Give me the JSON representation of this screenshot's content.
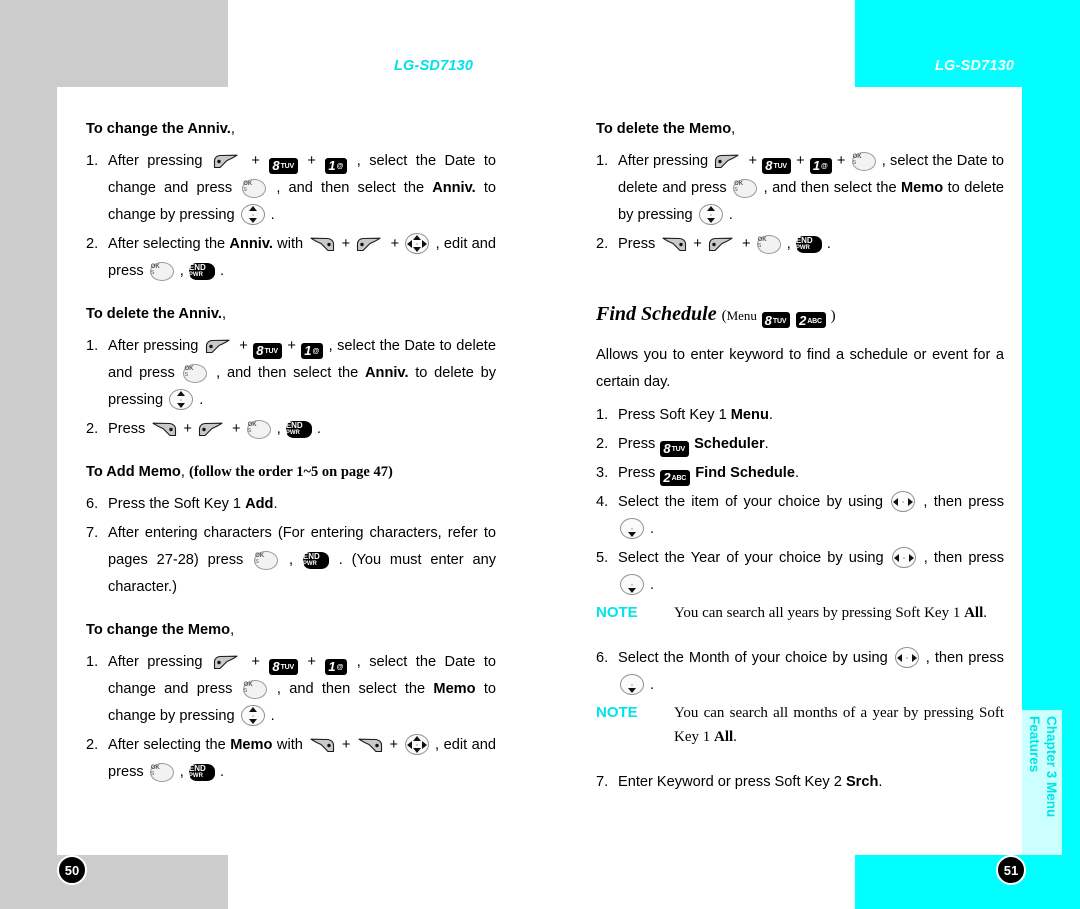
{
  "colors": {
    "cyan": "#00ffff",
    "cyan_text": "#00e5e5",
    "gray_block": "#cccccc",
    "tab_fill": "#ccffff"
  },
  "header": {
    "left_model": "LG-SD7130",
    "right_model": "LG-SD7130"
  },
  "page_numbers": {
    "left": "50",
    "right": "51"
  },
  "chapter_tab": {
    "line1": "Chapter 3",
    "line2": "Menu Features"
  },
  "left_page": {
    "sections": [
      {
        "title": "To change the Anniv.",
        "title_comma": ",",
        "items": [
          {
            "num": "1.",
            "parts": [
              {
                "t": "text",
                "v": "After  pressing  "
              },
              {
                "t": "key",
                "v": "send-key"
              },
              {
                "t": "text",
                "v": " + "
              },
              {
                "t": "numkey",
                "digit": "8",
                "sub": "TUV"
              },
              {
                "t": "text",
                "v": " + "
              },
              {
                "t": "numkey",
                "digit": "1",
                "sub": "@"
              },
              {
                "t": "text",
                "v": " ,  select  the  Date  to  change and press "
              },
              {
                "t": "key",
                "v": "ok-key"
              },
              {
                "t": "text",
                "v": " , and then select the "
              },
              {
                "t": "bold",
                "v": "Anniv."
              },
              {
                "t": "text",
                "v": " to change by pressing "
              },
              {
                "t": "key",
                "v": "nav-updown-key"
              },
              {
                "t": "text",
                "v": " ."
              }
            ]
          },
          {
            "num": "2.",
            "parts": [
              {
                "t": "text",
                "v": "After selecting the "
              },
              {
                "t": "bold",
                "v": "Anniv."
              },
              {
                "t": "text",
                "v": " with "
              },
              {
                "t": "key",
                "v": "end-call-key"
              },
              {
                "t": "text",
                "v": " + "
              },
              {
                "t": "key",
                "v": "send-key"
              },
              {
                "t": "text",
                "v": " + "
              },
              {
                "t": "key",
                "v": "nav-4way-key"
              },
              {
                "t": "text",
                "v": " , edit and press "
              },
              {
                "t": "key",
                "v": "ok-key"
              },
              {
                "t": "text",
                "v": " , "
              },
              {
                "t": "key",
                "v": "end-pwr-key"
              },
              {
                "t": "text",
                "v": " ."
              }
            ]
          }
        ]
      },
      {
        "title": "To delete the Anniv.",
        "title_comma": ",",
        "items": [
          {
            "num": "1.",
            "parts": [
              {
                "t": "text",
                "v": "After  pressing  "
              },
              {
                "t": "key",
                "v": "send-key"
              },
              {
                "t": "text",
                "v": " + "
              },
              {
                "t": "numkey",
                "digit": "8",
                "sub": "TUV"
              },
              {
                "t": "text",
                "v": " + "
              },
              {
                "t": "numkey",
                "digit": "1",
                "sub": "@"
              },
              {
                "t": "text",
                "v": " ,  select  the  Date  to  delete and press "
              },
              {
                "t": "key",
                "v": "ok-key"
              },
              {
                "t": "text",
                "v": " , and then select the  "
              },
              {
                "t": "bold",
                "v": "Anniv."
              },
              {
                "t": "text",
                "v": " to delete by pressing "
              },
              {
                "t": "key",
                "v": "nav-updown-key"
              },
              {
                "t": "text",
                "v": " ."
              }
            ]
          },
          {
            "num": "2.",
            "parts": [
              {
                "t": "text",
                "v": "Press "
              },
              {
                "t": "key",
                "v": "end-call-key"
              },
              {
                "t": "text",
                "v": " + "
              },
              {
                "t": "key",
                "v": "send-key"
              },
              {
                "t": "text",
                "v": " + "
              },
              {
                "t": "key",
                "v": "ok-key"
              },
              {
                "t": "text",
                "v": " , "
              },
              {
                "t": "key",
                "v": "end-pwr-key"
              },
              {
                "t": "text",
                "v": " ."
              }
            ]
          }
        ]
      },
      {
        "title": "To Add Memo",
        "title_comma": ",",
        "title_note": "(follow the order 1~5 on page 47)",
        "items": [
          {
            "num": "6.",
            "parts": [
              {
                "t": "text",
                "v": "Press the Soft Key 1 "
              },
              {
                "t": "bold",
                "v": "Add"
              },
              {
                "t": "text",
                "v": "."
              }
            ]
          },
          {
            "num": "7.",
            "parts": [
              {
                "t": "text",
                "v": "After  entering  characters  (For  entering  characters, refer  to  pages  27-28)  press  "
              },
              {
                "t": "key",
                "v": "ok-key"
              },
              {
                "t": "text",
                "v": " , "
              },
              {
                "t": "key",
                "v": "end-pwr-key"
              },
              {
                "t": "text",
                "v": " .  (You  must enter any character.)"
              }
            ]
          }
        ]
      },
      {
        "title": "To change the Memo",
        "title_comma": ",",
        "items": [
          {
            "num": "1.",
            "parts": [
              {
                "t": "text",
                "v": "After  pressing  "
              },
              {
                "t": "key",
                "v": "send-key"
              },
              {
                "t": "text",
                "v": " + "
              },
              {
                "t": "numkey",
                "digit": "8",
                "sub": "TUV"
              },
              {
                "t": "text",
                "v": " + "
              },
              {
                "t": "numkey",
                "digit": "1",
                "sub": "@"
              },
              {
                "t": "text",
                "v": " ,  select  the  Date  to  change and press "
              },
              {
                "t": "key",
                "v": "ok-key"
              },
              {
                "t": "text",
                "v": " , and then select the "
              },
              {
                "t": "bold",
                "v": "Memo"
              },
              {
                "t": "text",
                "v": " to change by pressing "
              },
              {
                "t": "key",
                "v": "nav-updown-key"
              },
              {
                "t": "text",
                "v": " ."
              }
            ]
          },
          {
            "num": "2.",
            "parts": [
              {
                "t": "text",
                "v": "After selecting the "
              },
              {
                "t": "bold",
                "v": "Memo"
              },
              {
                "t": "text",
                "v": " with "
              },
              {
                "t": "key",
                "v": "end-call-key"
              },
              {
                "t": "text",
                "v": " + "
              },
              {
                "t": "key",
                "v": "end-call-key"
              },
              {
                "t": "text",
                "v": " + "
              },
              {
                "t": "key",
                "v": "nav-4way-key"
              },
              {
                "t": "text",
                "v": " , edit and press "
              },
              {
                "t": "key",
                "v": "ok-key"
              },
              {
                "t": "text",
                "v": " , "
              },
              {
                "t": "key",
                "v": "end-pwr-key"
              },
              {
                "t": "text",
                "v": " ."
              }
            ]
          }
        ]
      }
    ]
  },
  "right_page": {
    "section_delete_memo": {
      "title": "To delete the Memo",
      "title_comma": ",",
      "items": [
        {
          "num": "1.",
          "parts": [
            {
              "t": "text",
              "v": "After   pressing   "
            },
            {
              "t": "key",
              "v": "send-key"
            },
            {
              "t": "text",
              "v": " + "
            },
            {
              "t": "numkey",
              "digit": "8",
              "sub": "TUV"
            },
            {
              "t": "text",
              "v": " + "
            },
            {
              "t": "numkey",
              "digit": "1",
              "sub": "@"
            },
            {
              "t": "text",
              "v": " + "
            },
            {
              "t": "key",
              "v": "ok-key"
            },
            {
              "t": "text",
              "v": " ,  select  the Date  to  delete  and  press "
            },
            {
              "t": "key",
              "v": "ok-key"
            },
            {
              "t": "text",
              "v": " ,  and  then  select  the "
            },
            {
              "t": "bold",
              "v": "Memo"
            },
            {
              "t": "text",
              "v": " to delete by pressing "
            },
            {
              "t": "key",
              "v": "nav-updown-key"
            },
            {
              "t": "text",
              "v": " ."
            }
          ]
        },
        {
          "num": "2.",
          "parts": [
            {
              "t": "text",
              "v": "Press "
            },
            {
              "t": "key",
              "v": "end-call-key"
            },
            {
              "t": "text",
              "v": " + "
            },
            {
              "t": "key",
              "v": "send-key"
            },
            {
              "t": "text",
              "v": " + "
            },
            {
              "t": "key",
              "v": "ok-key"
            },
            {
              "t": "text",
              "v": " , "
            },
            {
              "t": "key",
              "v": "end-pwr-key"
            },
            {
              "t": "text",
              "v": " ."
            }
          ]
        }
      ]
    },
    "find_schedule": {
      "heading": "Find Schedule",
      "heading_menu_word": "Menu",
      "heading_key1": {
        "digit": "8",
        "sub": "TUV"
      },
      "heading_key2": {
        "digit": "2",
        "sub": "ABC"
      },
      "intro": "Allows you to enter keyword to find a schedule or event for a certain day.",
      "items": [
        {
          "num": "1.",
          "parts": [
            {
              "t": "text",
              "v": "Press Soft Key 1 "
            },
            {
              "t": "bold",
              "v": "Menu"
            },
            {
              "t": "text",
              "v": "."
            }
          ]
        },
        {
          "num": "2.",
          "parts": [
            {
              "t": "text",
              "v": "Press "
            },
            {
              "t": "numkey",
              "digit": "8",
              "sub": "TUV"
            },
            {
              "t": "text",
              "v": "  "
            },
            {
              "t": "bold",
              "v": "Scheduler"
            },
            {
              "t": "text",
              "v": "."
            }
          ]
        },
        {
          "num": "3.",
          "parts": [
            {
              "t": "text",
              "v": "Press "
            },
            {
              "t": "numkey",
              "digit": "2",
              "sub": "ABC"
            },
            {
              "t": "text",
              "v": "  "
            },
            {
              "t": "bold",
              "v": "Find Schedule"
            },
            {
              "t": "text",
              "v": "."
            }
          ]
        },
        {
          "num": "4.",
          "parts": [
            {
              "t": "text",
              "v": "Select  the  item  of  your  choice  by  using  "
            },
            {
              "t": "key",
              "v": "nav-leftright-key"
            },
            {
              "t": "text",
              "v": " ,  then press "
            },
            {
              "t": "key",
              "v": "nav-down-key"
            },
            {
              "t": "text",
              "v": " ."
            }
          ]
        },
        {
          "num": "5.",
          "parts": [
            {
              "t": "text",
              "v": "Select  the  Year  of  your  choice  by  using  "
            },
            {
              "t": "key",
              "v": "nav-leftright-key"
            },
            {
              "t": "text",
              "v": " ,  then press "
            },
            {
              "t": "key",
              "v": "nav-down-key"
            },
            {
              "t": "text",
              "v": " ."
            }
          ]
        }
      ],
      "note1": {
        "label": "NOTE",
        "text_before": "You can search all years by pressing Soft Key 1 ",
        "bold": "All",
        "text_after": "."
      },
      "items2": [
        {
          "num": "6.",
          "parts": [
            {
              "t": "text",
              "v": "Select  the  Month  of  your  choice  by  using  "
            },
            {
              "t": "key",
              "v": "nav-leftright-key"
            },
            {
              "t": "text",
              "v": " ,  then press "
            },
            {
              "t": "key",
              "v": "nav-down-key"
            },
            {
              "t": "text",
              "v": " ."
            }
          ]
        }
      ],
      "note2": {
        "label": "NOTE",
        "text_before": "You can search all months of a year by pressing Soft Key 1 ",
        "bold": "All",
        "text_after": "."
      },
      "items3": [
        {
          "num": "7.",
          "parts": [
            {
              "t": "text",
              "v": "Enter Keyword or press Soft Key 2 "
            },
            {
              "t": "bold",
              "v": "Srch"
            },
            {
              "t": "text",
              "v": "."
            }
          ]
        }
      ]
    }
  }
}
